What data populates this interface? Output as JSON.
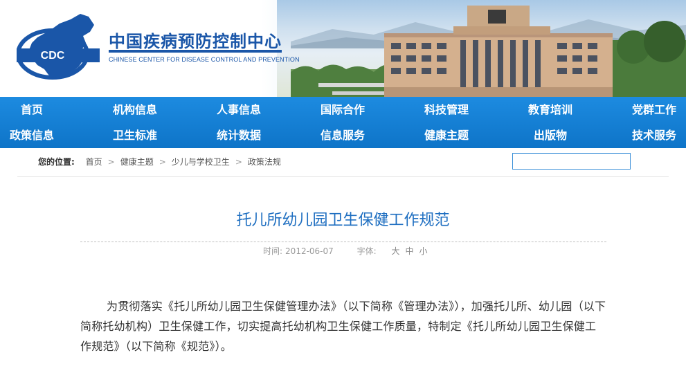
{
  "header": {
    "logo_abbr": "CDC",
    "title_cn": "中国疾病预防控制中心",
    "title_en": "CHINESE CENTER FOR DISEASE CONTROL AND PREVENTION"
  },
  "nav": {
    "row1": [
      "首页",
      "机构信息",
      "人事信息",
      "国际合作",
      "科技管理",
      "教育培训",
      "党群工作"
    ],
    "row2": [
      "政策信息",
      "卫生标准",
      "统计数据",
      "信息服务",
      "健康主题",
      "出版物",
      "技术服务"
    ]
  },
  "breadcrumb": {
    "label": "您的位置:",
    "items": [
      "首页",
      "健康主题",
      "少儿与学校卫生",
      "政策法规"
    ],
    "separator": ">"
  },
  "search": {
    "value": "",
    "placeholder": ""
  },
  "article": {
    "title": "托儿所幼儿园卫生保健工作规范",
    "time_label": "时间:",
    "date": "2012-06-07",
    "font_label": "字体:",
    "font_sizes": [
      "大",
      "中",
      "小"
    ],
    "paragraph": "为贯彻落实《托儿所幼儿园卫生保健管理办法》（以下简称《管理办法》），加强托儿所、幼儿园（以下简称托幼机构）卫生保健工作，切实提高托幼机构卫生保健工作质量，特制定《托儿所幼儿园卫生保健工作规范》（以下简称《规范》）。"
  },
  "colors": {
    "brand_blue": "#1a56a8",
    "nav_blue": "#0e74c8",
    "title_blue": "#1f6fc1"
  }
}
